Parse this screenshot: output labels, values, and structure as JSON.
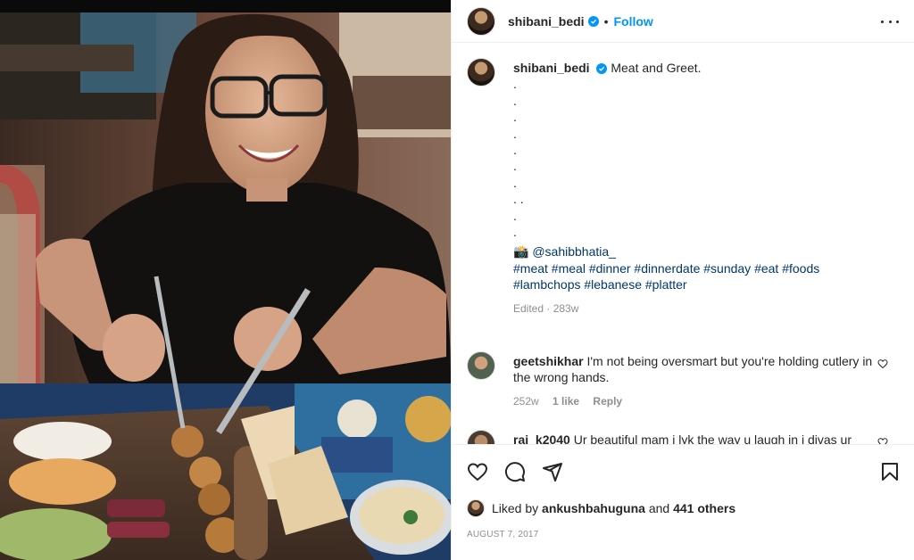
{
  "post": {
    "author": "shibani_bedi",
    "follow_label": "Follow",
    "separator": "•",
    "caption_text": "Meat and Greet.",
    "caption_dots": [
      ".",
      ".",
      ".",
      ".",
      ".",
      ".",
      ".",
      ". .",
      ".",
      "."
    ],
    "camera_emoji": "📸",
    "mention": "@sahibbhatia_",
    "hashtags": "#meat #meal #dinner #dinnerdate #sunday #eat #foods #lambchops #lebanese #platter",
    "edited_label": "Edited · 283w"
  },
  "comments": [
    {
      "user": "geetshikhar",
      "text": "I'm not being oversmart but you're holding cutlery in the wrong hands.",
      "age": "252w",
      "likes": "1 like",
      "reply": "Reply",
      "avatar_color": "#6b7d6a"
    },
    {
      "user": "raj_k2040",
      "text": "Ur beautiful mam i lyk the way u laugh in i divas ur",
      "avatar_color": "#5a4a3e"
    }
  ],
  "liked_by": {
    "prefix": "Liked by",
    "user": "ankushbahuguna",
    "conjunction": "and",
    "others": "441 others"
  },
  "date": "AUGUST 7, 2017",
  "colors": {
    "accent": "#0095f6",
    "link": "#00376b",
    "muted": "#8e8e8e"
  },
  "icons": [
    "more-options-icon",
    "heart-icon",
    "comment-icon",
    "share-icon",
    "bookmark-icon",
    "verified-badge-icon"
  ]
}
